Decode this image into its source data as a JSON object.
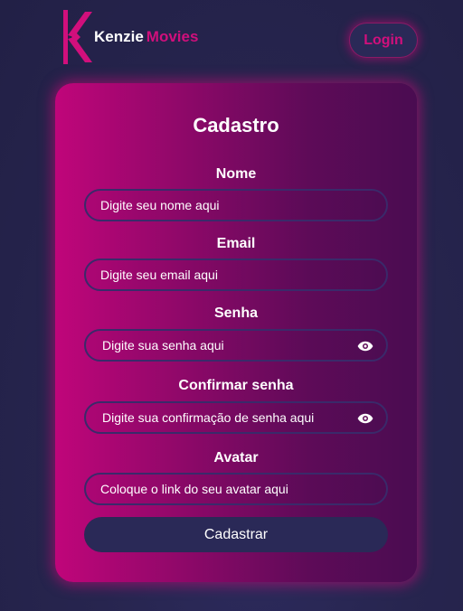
{
  "brand": {
    "name_primary": "Kenzie",
    "name_secondary": "Movies",
    "accent": "#d10f7c"
  },
  "header": {
    "login_label": "Login"
  },
  "form": {
    "title": "Cadastro",
    "fields": [
      {
        "label": "Nome",
        "placeholder": "Digite seu nome aqui",
        "type": "text"
      },
      {
        "label": "Email",
        "placeholder": "Digite seu email aqui",
        "type": "email"
      },
      {
        "label": "Senha",
        "placeholder": "Digite sua senha aqui",
        "type": "password",
        "icon": "eye-icon"
      },
      {
        "label": "Confirmar senha",
        "placeholder": "Digite sua confirmação de senha aqui",
        "type": "password",
        "icon": "eye-icon"
      },
      {
        "label": "Avatar",
        "placeholder": "Coloque o link do seu avatar aqui",
        "type": "text"
      }
    ],
    "submit_label": "Cadastrar"
  },
  "colors": {
    "background": "#27254f",
    "card_start": "#c0057a",
    "card_end": "#4a0c51",
    "button": "#2a2957"
  }
}
